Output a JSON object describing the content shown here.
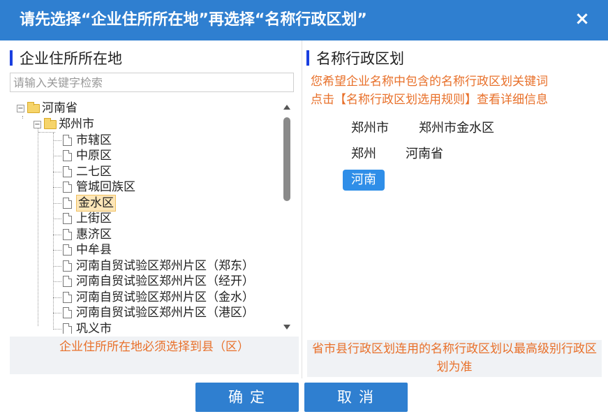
{
  "dialog": {
    "title": "请先选择“企业住所所在地”再选择“名称行政区划”",
    "close_label": "×"
  },
  "left": {
    "section_title": "企业住所所在地",
    "search_placeholder": "请输入关键字检索",
    "footer": "企业住所所在地必须选择到县（区）",
    "tree": {
      "province": "河南省",
      "city": "郑州市",
      "districts": [
        "市辖区",
        "中原区",
        "二七区",
        "管城回族区",
        "金水区",
        "上街区",
        "惠济区",
        "中牟县",
        "河南自贸试验区郑州片区（郑东）",
        "河南自贸试验区郑州片区（经开）",
        "河南自贸试验区郑州片区（金水）",
        "河南自贸试验区郑州片区（港区）",
        "巩义市"
      ],
      "selected": "金水区"
    }
  },
  "right": {
    "section_title": "名称行政区划",
    "hint_line1": "您希望企业名称中包含的名称行政区划关键词",
    "hint_line2": "点击【名称行政区划选用规则】查看详细信息",
    "chips": {
      "c1": "郑州市",
      "c2": "郑州市金水区",
      "c3": "郑州",
      "c4": "河南省",
      "c5": "河南"
    },
    "footer": "省市县行政区划连用的名称行政区划以最高级别行政区划为准"
  },
  "buttons": {
    "ok": "确定",
    "cancel": "取消"
  },
  "colors": {
    "titlebar": "#2f7fd0",
    "accent": "#1a3fe0",
    "warning_text": "#e8702a",
    "chip_active": "#2f8ee8",
    "selection": "#fde6b8"
  }
}
